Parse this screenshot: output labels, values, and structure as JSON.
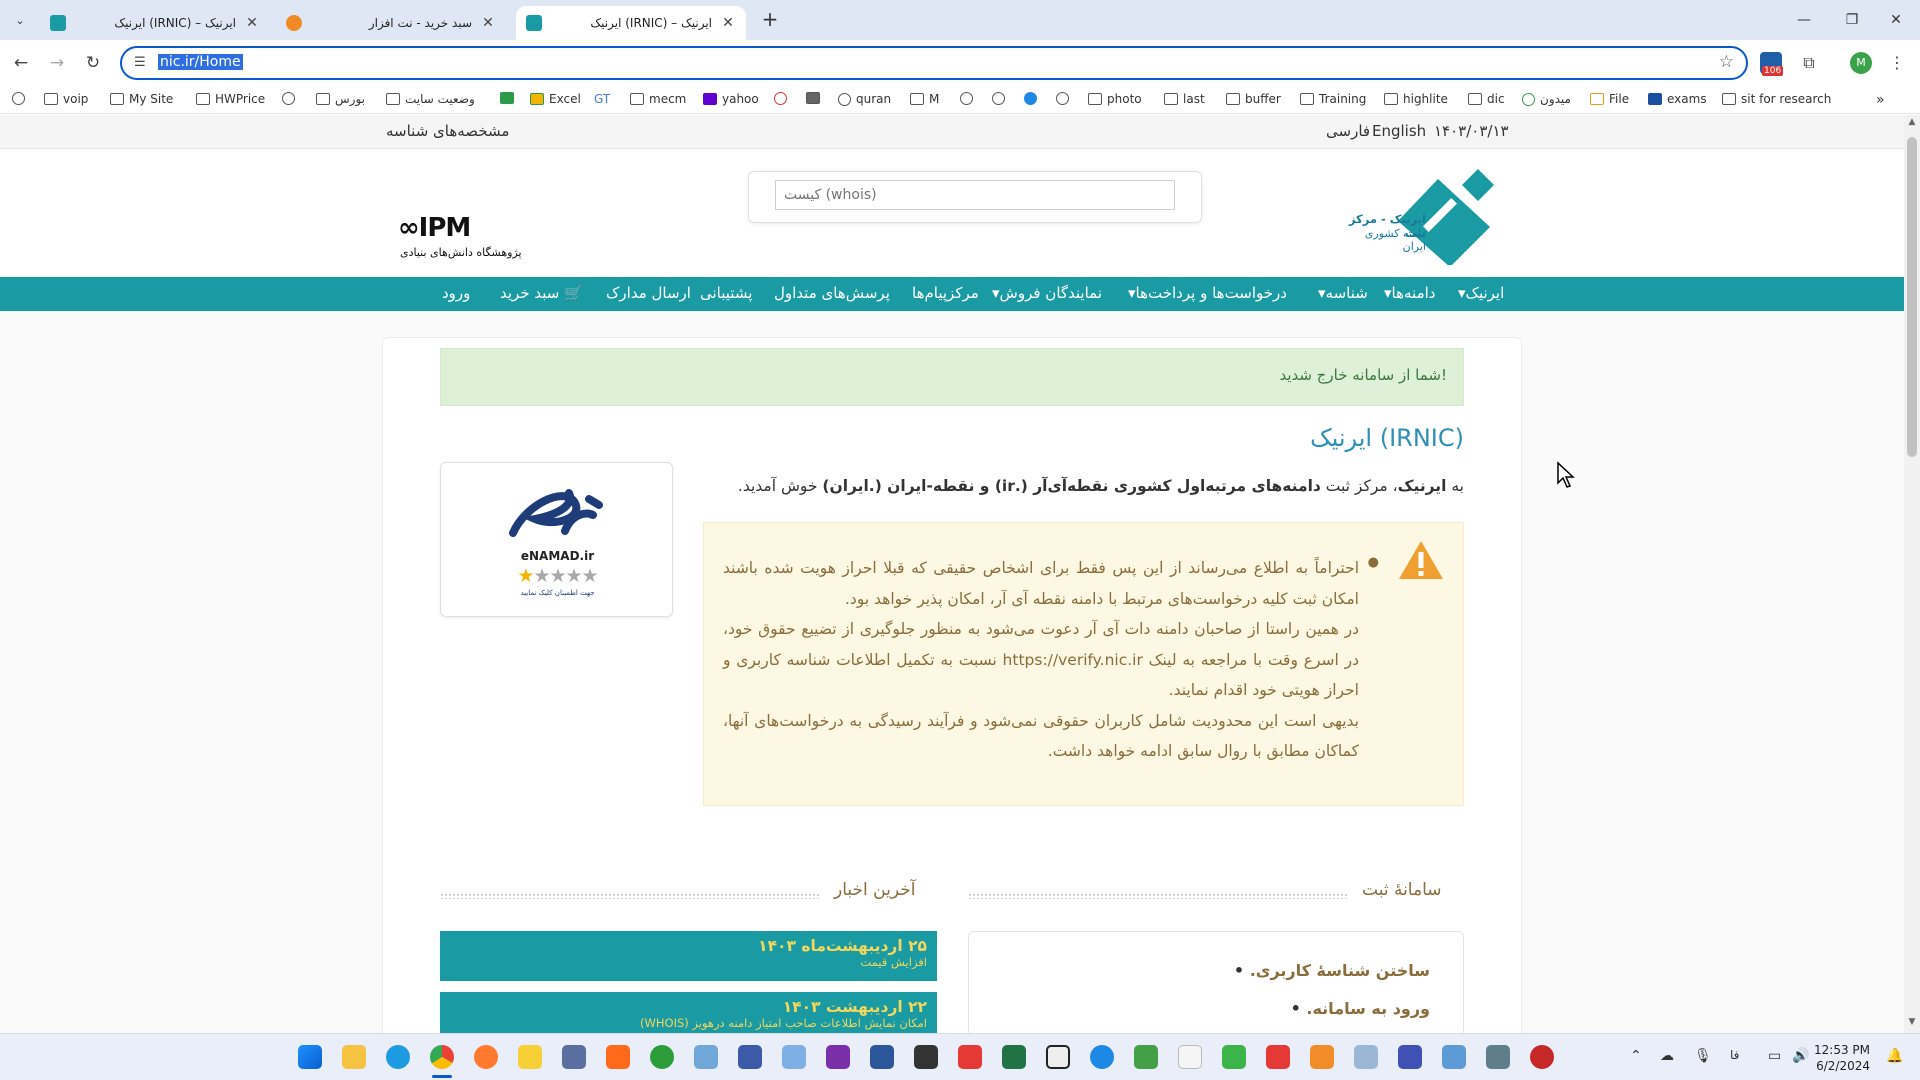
{
  "browser": {
    "tabs": [
      {
        "title": "ایرنیک (IRNIC) – ایرنیک",
        "active": false
      },
      {
        "title": "سبد خرید - نت افزار",
        "active": false
      },
      {
        "title": "ایرنیک (IRNIC) – ایرنیک",
        "active": true
      }
    ],
    "url": "nic.ir/Home",
    "profile_initial": "M",
    "ext_badge": "106",
    "bookmarks": [
      "voip",
      "My Site",
      "HWPrice",
      "بورس",
      "وضعیت سایت",
      "Excel",
      "GT",
      "mecm",
      "yahoo",
      "quran",
      "M",
      "photo",
      "last",
      "buffer",
      "Training",
      "highlite",
      "dic",
      "میدون",
      "File",
      "exams",
      "sit for research"
    ]
  },
  "site": {
    "topbar": {
      "date": "۱۴۰۳/۰۳/۱۳",
      "lang_en": "English",
      "lang_fa": "فارسی",
      "identity_link": "مشخصه‌های شناسه"
    },
    "logo_text_line1": "ایرنیک - مرکز ثبت",
    "logo_text_line2": "دامنه کشوری ایران",
    "ipm_logo": "IPM",
    "ipm_caption": "پژوهشگاه دانش‌های بنیادی",
    "whois_placeholder": "کیست (whois)",
    "menu": [
      {
        "label": "ایرنیک",
        "dropdown": true
      },
      {
        "label": "دامنه‌ها",
        "dropdown": true
      },
      {
        "label": "شناسه",
        "dropdown": true
      },
      {
        "label": "درخواست‌ها و پرداخت‌ها",
        "dropdown": true
      },
      {
        "label": "نمایندگان فروش",
        "dropdown": true
      },
      {
        "label": "مرکزپیام‌ها",
        "dropdown": false
      },
      {
        "label": "پرسش‌های متداول",
        "dropdown": false
      },
      {
        "label": "پشتیبانی",
        "dropdown": false
      },
      {
        "label": "ارسال مدارک",
        "dropdown": false
      },
      {
        "label": "سبد خرید",
        "dropdown": false
      },
      {
        "label": "ورود",
        "dropdown": false
      }
    ],
    "logout_message": "شما از سامانه خارج شدید!",
    "page_title": "ایرنیک (IRNIC)",
    "welcome_pre": "به ",
    "welcome_irnic": "ایرنیک",
    "welcome_mid": "، مرکز ثبت ",
    "welcome_bold": "دامنه‌های مرتبه‌اول کشوری نقطه‌آی‌آر (.ir) و نقطه-ایران (.ایران)",
    "welcome_post": " خوش آمدید.",
    "warning_lines": [
      "احتراماً به اطلاع می‌رساند از این پس فقط برای اشخاص حقیقی که قبلا احراز هویت شده باشند امکان ثبت کلیه درخواست‌های مرتبط با دامنه نقطه آی آر، امکان پذیر خواهد بود.",
      "در همین راستا از صاحبان دامنه دات آی آر دعوت می‌شود به منظور جلوگیری از تضییع حقوق خود، در اسرع وقت با مراجعه به لینک https://verify.nic.ir نسبت به تکمیل اطلاعات شناسه کاربری و احراز هویتی خود اقدام نمایند.",
      "بدیهی است این محدودیت شامل کاربران حقوقی نمی‌شود و فرآیند رسیدگی به درخواست‌های آنها، کماکان مطابق با روال سابق ادامه خواهد داشت."
    ],
    "enamad_label": "eNAMAD.ir",
    "enamad_caption": "جهت اطمینان کلیک نمایید",
    "enamad_rating": 1,
    "registration_title": "سامانهٔ ثبت",
    "registration_items": [
      "ساختن شناسهٔ کاربری.",
      "ورود به سامانه."
    ],
    "news_title": "آخرین اخبار",
    "news": [
      {
        "date": "۲۵ اردیبهشت‌ماه ۱۴۰۳",
        "summary": "افزایش قیمت"
      },
      {
        "date": "۲۲ اردیبهشت ۱۴۰۳",
        "summary": "امکان نمایش اطلاعات صاحب امتیاز دامنه درهویز (WHOIS)"
      }
    ]
  },
  "taskbar": {
    "time": "12:53 PM",
    "date": "6/2/2024",
    "lang": "فا"
  },
  "colors": {
    "teal": "#1a9aa3",
    "success_bg": "#dff0d8",
    "warning_bg": "#fcf8e3",
    "accent_text": "#8a6d3b"
  }
}
